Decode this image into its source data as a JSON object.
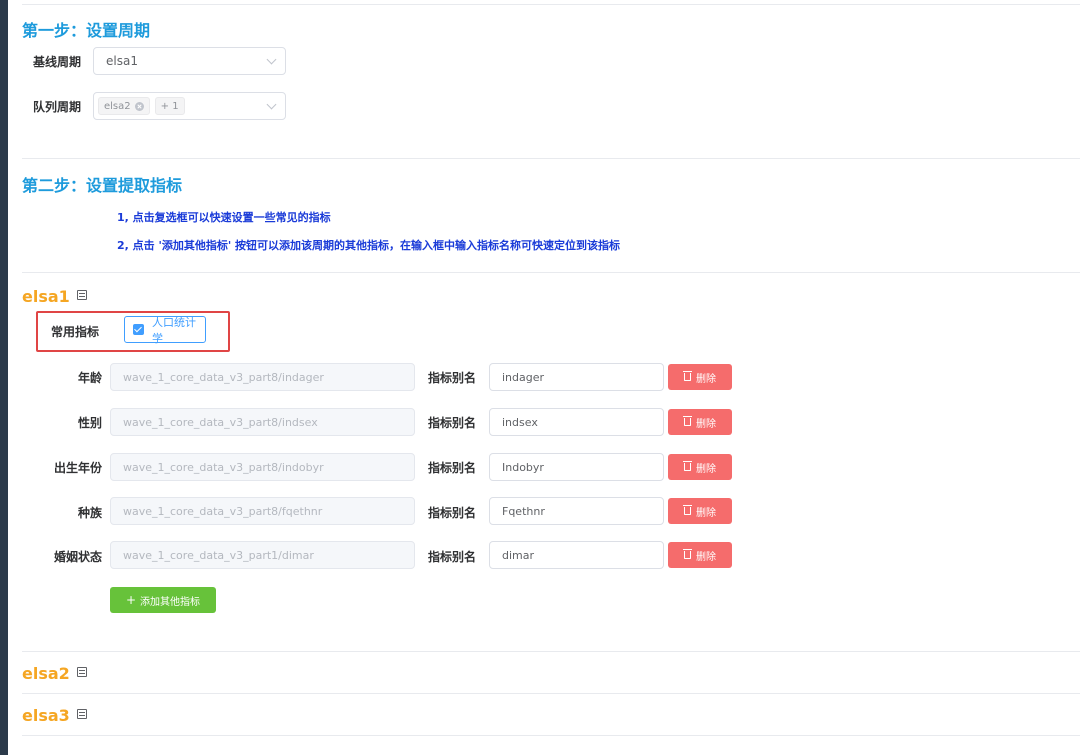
{
  "step1": {
    "title": "第一步：设置周期",
    "baseline_label": "基线周期",
    "baseline_value": "elsa1",
    "queue_label": "队列周期",
    "queue_tags": [
      "elsa2",
      "+ 1"
    ]
  },
  "step2": {
    "title": "第二步：设置提取指标",
    "hint1": "1, 点击复选框可以快速设置一些常见的指标",
    "hint2": "2, 点击 '添加其他指标' 按钮可以添加该周期的其他指标，在输入框中输入指标名称可快速定位到该指标"
  },
  "sections": [
    {
      "name": "elsa1",
      "common_label": "常用指标",
      "common_option": "人口统计学",
      "common_checked": true,
      "rows": [
        {
          "label": "年龄",
          "path": "wave_1_core_data_v3_part8/indager",
          "alias_label": "指标别名",
          "alias": "indager",
          "delete": "删除"
        },
        {
          "label": "性别",
          "path": "wave_1_core_data_v3_part8/indsex",
          "alias_label": "指标别名",
          "alias": "indsex",
          "delete": "删除"
        },
        {
          "label": "出生年份",
          "path": "wave_1_core_data_v3_part8/indobyr",
          "alias_label": "指标别名",
          "alias": "Indobyr",
          "delete": "删除"
        },
        {
          "label": "种族",
          "path": "wave_1_core_data_v3_part8/fqethnr",
          "alias_label": "指标别名",
          "alias": "Fqethnr",
          "delete": "删除"
        },
        {
          "label": "婚姻状态",
          "path": "wave_1_core_data_v3_part1/dimar",
          "alias_label": "指标别名",
          "alias": "dimar",
          "delete": "删除"
        }
      ],
      "add_button": "添加其他指标"
    },
    {
      "name": "elsa2"
    },
    {
      "name": "elsa3"
    }
  ],
  "colors": {
    "step_title": "#1e9bdc",
    "section_name": "#f5a623",
    "hint": "#1a3bd8",
    "delete": "#f56c6c",
    "add": "#67c23a",
    "highlight": "#e04545",
    "accent": "#409eff"
  }
}
